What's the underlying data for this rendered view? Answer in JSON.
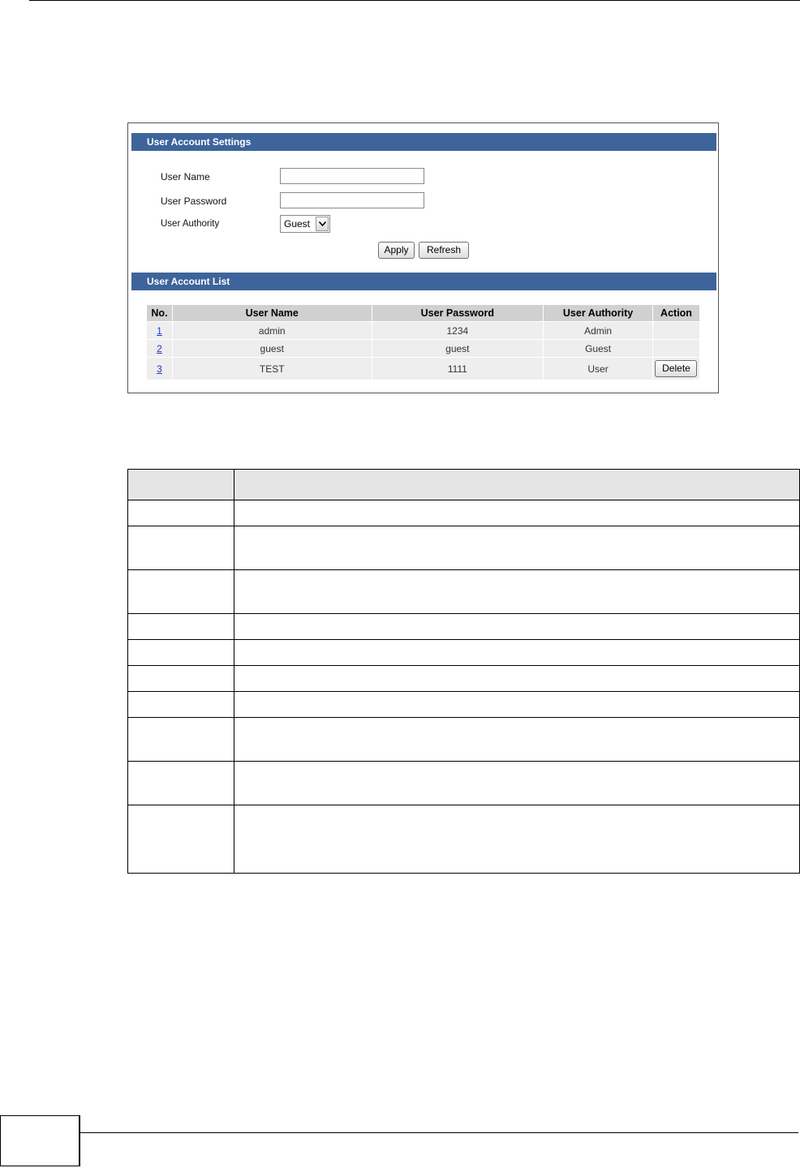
{
  "settings": {
    "title": "User Account Settings",
    "user_name_label": "User Name",
    "user_password_label": "User Password",
    "user_authority_label": "User Authority",
    "user_name_value": "",
    "user_password_value": "",
    "authority_selected": "Guest",
    "apply_label": "Apply",
    "refresh_label": "Refresh"
  },
  "list": {
    "title": "User Account List",
    "headers": [
      "No.",
      "User Name",
      "User Password",
      "User Authority",
      "Action"
    ],
    "rows": [
      {
        "no": "1",
        "user_name": "admin",
        "password": "1234",
        "authority": "Admin",
        "action": ""
      },
      {
        "no": "2",
        "user_name": "guest",
        "password": "guest",
        "authority": "Guest",
        "action": ""
      },
      {
        "no": "3",
        "user_name": "TEST",
        "password": "1111",
        "authority": "User",
        "action": "Delete"
      }
    ]
  },
  "colors": {
    "section_bar": "#3d649b",
    "header_cell": "#d0d0d0",
    "row_cell": "#eeeeee",
    "link": "#1f3ad0"
  },
  "icons": {
    "select_arrow": "chevron-down-icon"
  }
}
